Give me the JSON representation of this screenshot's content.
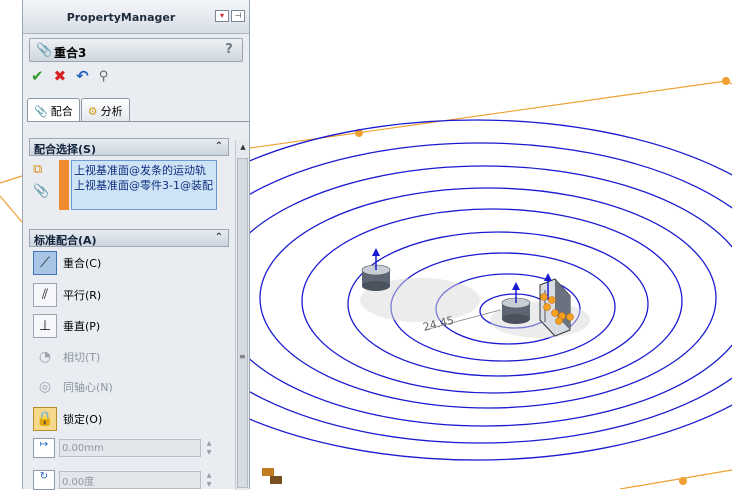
{
  "property_manager": {
    "title": "PropertyManager",
    "feature_name": "重合3",
    "help": "?",
    "tabs": [
      {
        "label": "配合"
      },
      {
        "label": "分析"
      }
    ],
    "mate_selections": {
      "header": "配合选择(S)",
      "items": [
        "上视基准面@发条的运动轨",
        "上视基准面@零件3-1@装配"
      ]
    },
    "standard_mates": {
      "header": "标准配合(A)",
      "items": [
        {
          "label": "重合(C)",
          "icon": "coincident-icon",
          "selected": true,
          "enabled": true
        },
        {
          "label": "平行(R)",
          "icon": "parallel-icon",
          "selected": false,
          "enabled": true
        },
        {
          "label": "垂直(P)",
          "icon": "perpendicular-icon",
          "selected": false,
          "enabled": true
        },
        {
          "label": "相切(T)",
          "icon": "tangent-icon",
          "selected": false,
          "enabled": false
        },
        {
          "label": "同轴心(N)",
          "icon": "concentric-icon",
          "selected": false,
          "enabled": false
        },
        {
          "label": "锁定(O)",
          "icon": "lock-icon",
          "selected": false,
          "enabled": true
        }
      ],
      "distance_value": "0.00mm",
      "angle_value": "0.00度"
    }
  },
  "viewport": {
    "dimension_label": "24.45",
    "colors": {
      "spiral": "#1a1ad0",
      "sketch_line": "#f0a030",
      "panel_bg": "#e9edf2"
    }
  }
}
